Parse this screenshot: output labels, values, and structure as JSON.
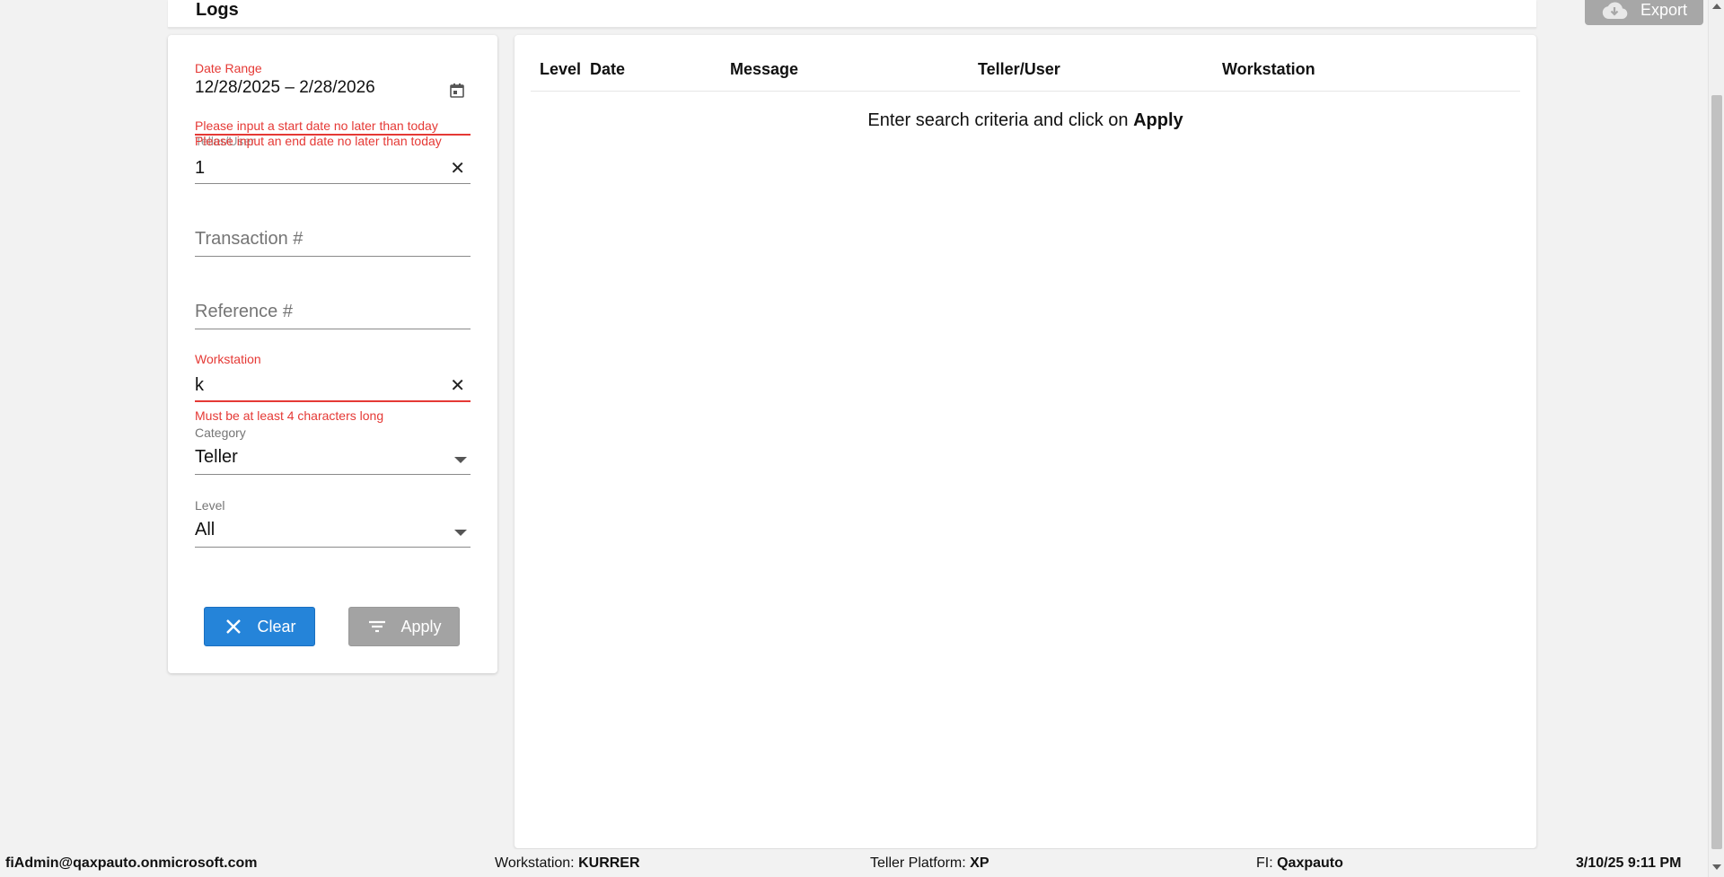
{
  "header": {
    "title": "Logs",
    "export_label": "Export"
  },
  "filters": {
    "date_range": {
      "label": "Date Range",
      "value": "12/28/2025 – 2/28/2026",
      "error_start": "Please input a start date no later than today",
      "error_end": "Please input an end date no later than today"
    },
    "teller_user": {
      "label": "Teller/User",
      "value": "1"
    },
    "transaction": {
      "placeholder": "Transaction #"
    },
    "reference": {
      "placeholder": "Reference #"
    },
    "workstation": {
      "label": "Workstation",
      "value": "k",
      "error": "Must be at least 4 characters long"
    },
    "category": {
      "label": "Category",
      "value": "Teller"
    },
    "level": {
      "label": "Level",
      "value": "All"
    },
    "clear_label": "Clear",
    "apply_label": "Apply"
  },
  "results": {
    "columns": [
      "Level",
      "Date",
      "Message",
      "Teller/User",
      "Workstation"
    ],
    "empty_prefix": "Enter search criteria and click on ",
    "empty_action": "Apply"
  },
  "status_bar": {
    "user": "fiAdmin@qaxpauto.onmicrosoft.com",
    "workstation_label": "Workstation: ",
    "workstation_value": "KURRER",
    "platform_label": "Teller Platform: ",
    "platform_value": "XP",
    "fi_label": "FI: ",
    "fi_value": "Qaxpauto",
    "datetime": "3/10/25 9:11 PM"
  },
  "colors": {
    "accent": "#2584d9",
    "error": "#e53935",
    "disabled": "#a3a3a3"
  },
  "icons": [
    "cloud-download-icon",
    "calendar-icon",
    "close-icon",
    "chevron-down-icon",
    "filter-icon"
  ]
}
